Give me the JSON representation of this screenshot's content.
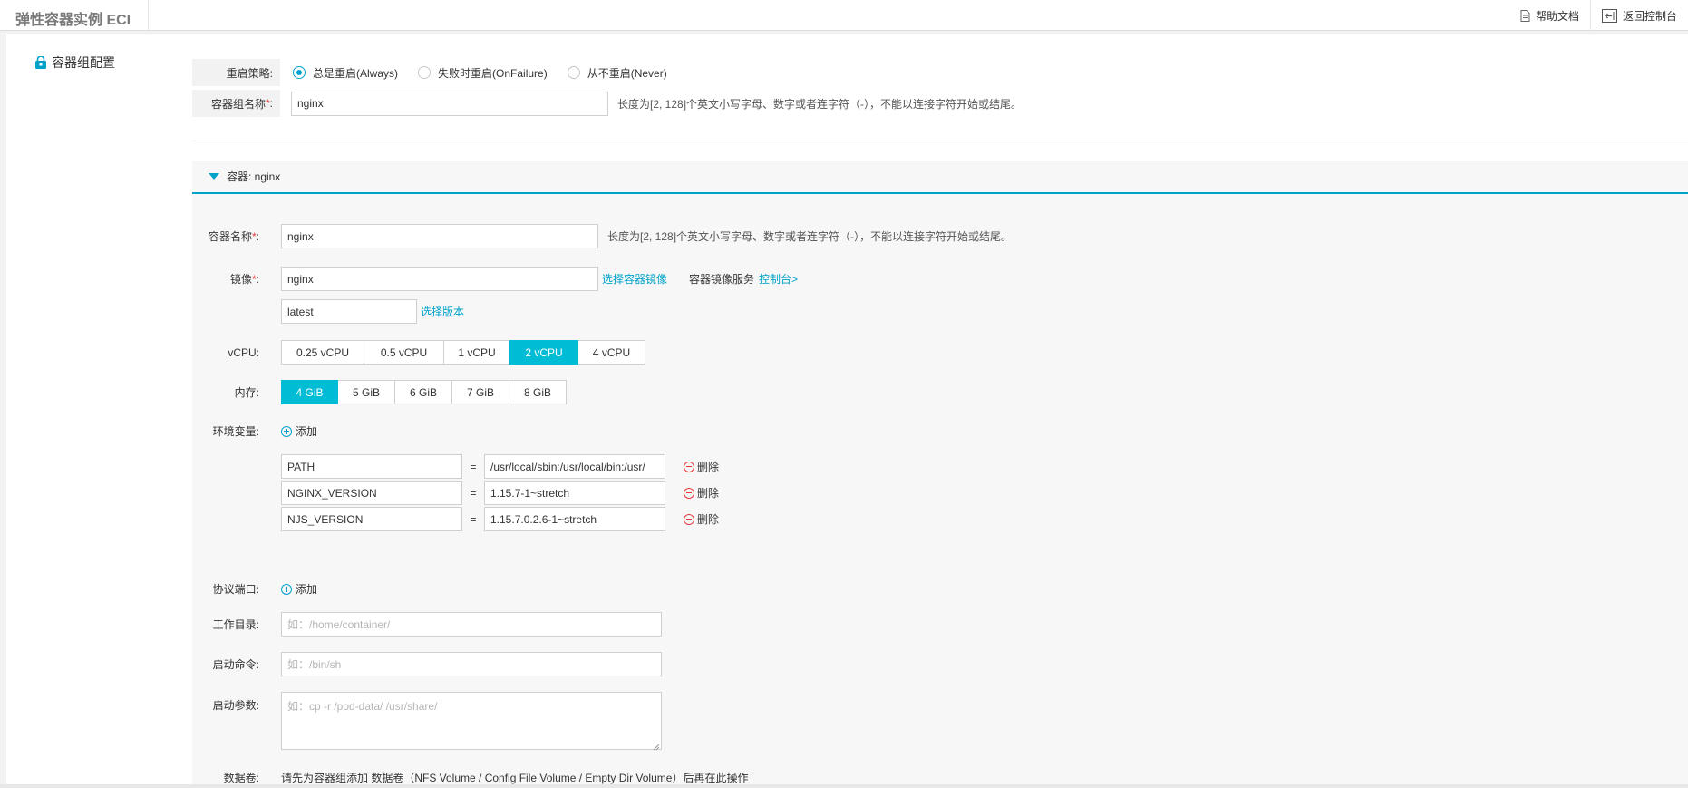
{
  "header": {
    "brand": "弹性容器实例 ECI",
    "help_label": "帮助文档",
    "back_label": "返回控制台"
  },
  "sidebar": {
    "title": "容器组配置"
  },
  "group": {
    "restart_label": "重启策略:",
    "restart_options": [
      {
        "label": "总是重启(Always)",
        "checked": true
      },
      {
        "label": "失败时重启(OnFailure)",
        "checked": false
      },
      {
        "label": "从不重启(Never)",
        "checked": false
      }
    ],
    "name_label": "容器组名称",
    "name_required": "*",
    "name_colon": ":",
    "name_value": "nginx",
    "name_hint": "长度为[2, 128]个英文小写字母、数字或者连字符（-），不能以连接字符开始或结尾。"
  },
  "container": {
    "header": "容器: nginx",
    "name_label": "容器名称",
    "name_required": "*",
    "name_colon": ":",
    "name_value": "nginx",
    "name_hint": "长度为[2, 128]个英文小写字母、数字或者连字符（-），不能以连接字符开始或结尾。",
    "image_label": "镜像",
    "image_required": "*",
    "image_colon": ":",
    "image_value": "nginx",
    "select_image_link": "选择容器镜像",
    "registry_text": "容器镜像服务",
    "console_link": "控制台>",
    "tag_value": "latest",
    "select_version_link": "选择版本",
    "vcpu_label": "vCPU:",
    "vcpu_options": [
      "0.25 vCPU",
      "0.5 vCPU",
      "1 vCPU",
      "2 vCPU",
      "4 vCPU"
    ],
    "vcpu_selected": "2 vCPU",
    "memory_label": "内存:",
    "memory_options": [
      "4 GiB",
      "5 GiB",
      "6 GiB",
      "7 GiB",
      "8 GiB"
    ],
    "memory_selected": "4 GiB",
    "env_label": "环境变量:",
    "add_label": "添加",
    "env_vars": [
      {
        "key": "PATH",
        "value": "/usr/local/sbin:/usr/local/bin:/usr/"
      },
      {
        "key": "NGINX_VERSION",
        "value": "1.15.7-1~stretch"
      },
      {
        "key": "NJS_VERSION",
        "value": "1.15.7.0.2.6-1~stretch"
      }
    ],
    "eq": "=",
    "delete_label": "删除",
    "ports_label": "协议端口:",
    "workdir_label": "工作目录:",
    "workdir_placeholder": "如：/home/container/",
    "command_label": "启动命令:",
    "command_placeholder": "如：/bin/sh",
    "args_label": "启动参数:",
    "args_placeholder": "如：cp -r /pod-data/ /usr/share/",
    "volume_label": "数据卷:",
    "volume_text": "请先为容器组添加 数据卷（NFS Volume / Config File Volume / Empty Dir Volume）后再在此操作"
  },
  "colors": {
    "accent": "#00a2ca",
    "active_segment": "#00bcd4",
    "required": "#e4393c"
  }
}
